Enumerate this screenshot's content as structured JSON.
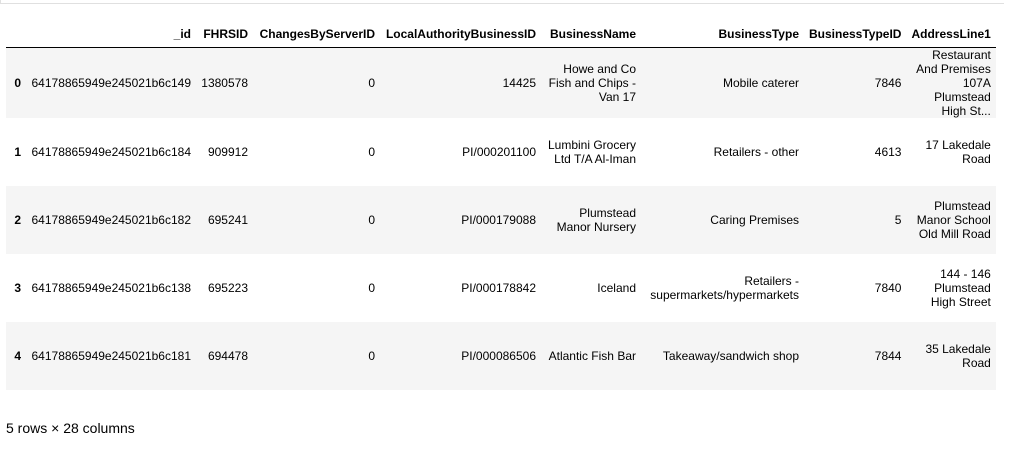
{
  "table": {
    "columns": [
      "",
      "_id",
      "FHRSID",
      "ChangesByServerID",
      "LocalAuthorityBusinessID",
      "BusinessName",
      "BusinessType",
      "BusinessTypeID",
      "AddressLine1"
    ],
    "rows": [
      {
        "index": "0",
        "id": "64178865949e245021b6c149",
        "fhrsid": "1380578",
        "changes": "0",
        "lab_id": "14425",
        "business_name": "Howe and Co Fish and Chips - Van 17",
        "business_type": "Mobile caterer",
        "business_type_id": "7846",
        "address_line1": "Restaurant And Premises 107A Plumstead High St..."
      },
      {
        "index": "1",
        "id": "64178865949e245021b6c184",
        "fhrsid": "909912",
        "changes": "0",
        "lab_id": "PI/000201100",
        "business_name": "Lumbini Grocery Ltd T/A Al-Iman",
        "business_type": "Retailers - other",
        "business_type_id": "4613",
        "address_line1": "17 Lakedale Road"
      },
      {
        "index": "2",
        "id": "64178865949e245021b6c182",
        "fhrsid": "695241",
        "changes": "0",
        "lab_id": "PI/000179088",
        "business_name": "Plumstead Manor Nursery",
        "business_type": "Caring Premises",
        "business_type_id": "5",
        "address_line1": "Plumstead Manor School Old Mill Road"
      },
      {
        "index": "3",
        "id": "64178865949e245021b6c138",
        "fhrsid": "695223",
        "changes": "0",
        "lab_id": "PI/000178842",
        "business_name": "Iceland",
        "business_type": "Retailers - supermarkets/hypermarkets",
        "business_type_id": "7840",
        "address_line1": "144 - 146 Plumstead High Street"
      },
      {
        "index": "4",
        "id": "64178865949e245021b6c181",
        "fhrsid": "694478",
        "changes": "0",
        "lab_id": "PI/000086506",
        "business_name": "Atlantic Fish Bar",
        "business_type": "Takeaway/sandwich shop",
        "business_type_id": "7844",
        "address_line1": "35 Lakedale Road"
      }
    ]
  },
  "footer": {
    "shape_text": "5 rows × 28 columns"
  }
}
